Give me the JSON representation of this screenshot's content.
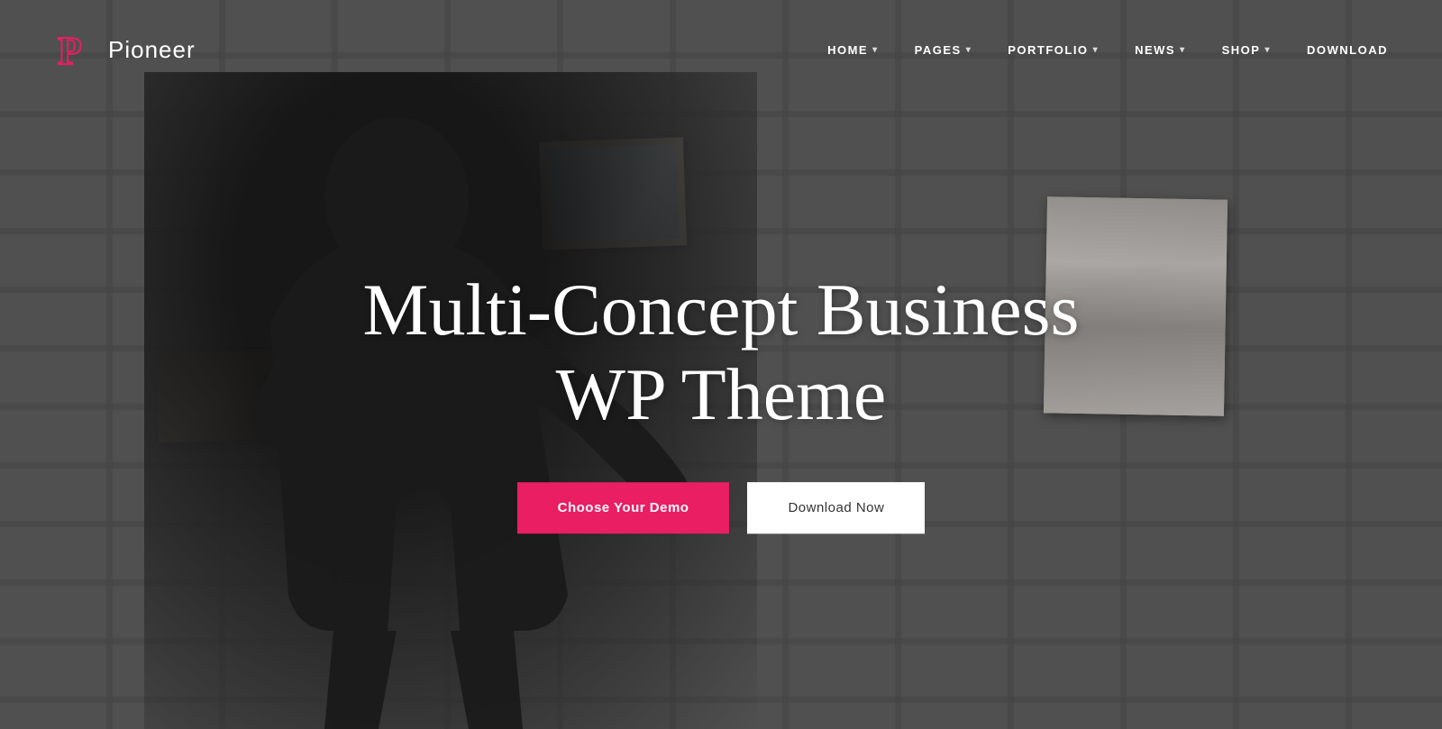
{
  "site": {
    "logo_text": "Pioneer",
    "logo_icon_color": "#e91e63"
  },
  "nav": {
    "items": [
      {
        "label": "HOME",
        "has_dropdown": true
      },
      {
        "label": "PAGES",
        "has_dropdown": true
      },
      {
        "label": "PORTFOLIO",
        "has_dropdown": true
      },
      {
        "label": "NEWS",
        "has_dropdown": true
      },
      {
        "label": "SHOP",
        "has_dropdown": true
      },
      {
        "label": "DOWNLOAD",
        "has_dropdown": false
      }
    ]
  },
  "hero": {
    "title_line1": "Multi-Concept Business",
    "title_line2": "WP Theme",
    "btn_demo": "Choose Your Demo",
    "btn_download": "Download Now"
  },
  "colors": {
    "accent": "#e91e63",
    "white": "#ffffff",
    "dark": "#333333"
  }
}
